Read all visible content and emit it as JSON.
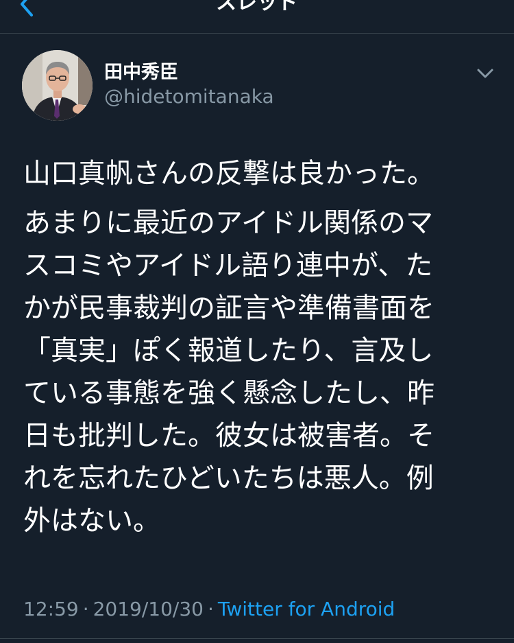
{
  "header": {
    "title": "スレッド"
  },
  "tweet": {
    "author": {
      "display_name": "田中秀臣",
      "handle": "@hidetomitanaka"
    },
    "paragraphs": [
      "山口真帆さんの反撃は良かった。",
      "あまりに最近のアイドル関係のマ\nスコミやアイドル語り連中が、た\nかが民事裁判の証言や準備書面を\n「真実」ぽく報道したり、言及し\nている事態を強く懸念したし、昨\n日も批判した。彼女は被害者。そ\nれを忘れたひどいたちは悪人。例\n外はない。"
    ],
    "time": "12:59",
    "date": "2019/10/30",
    "separator": "·",
    "source": "Twitter for Android"
  },
  "colors": {
    "background": "#151f2b",
    "accent": "#1da1f2",
    "secondary_text": "#8899a6",
    "divider": "#38444d"
  },
  "icons": {
    "back": "chevron-left-icon",
    "more": "chevron-down-icon"
  }
}
